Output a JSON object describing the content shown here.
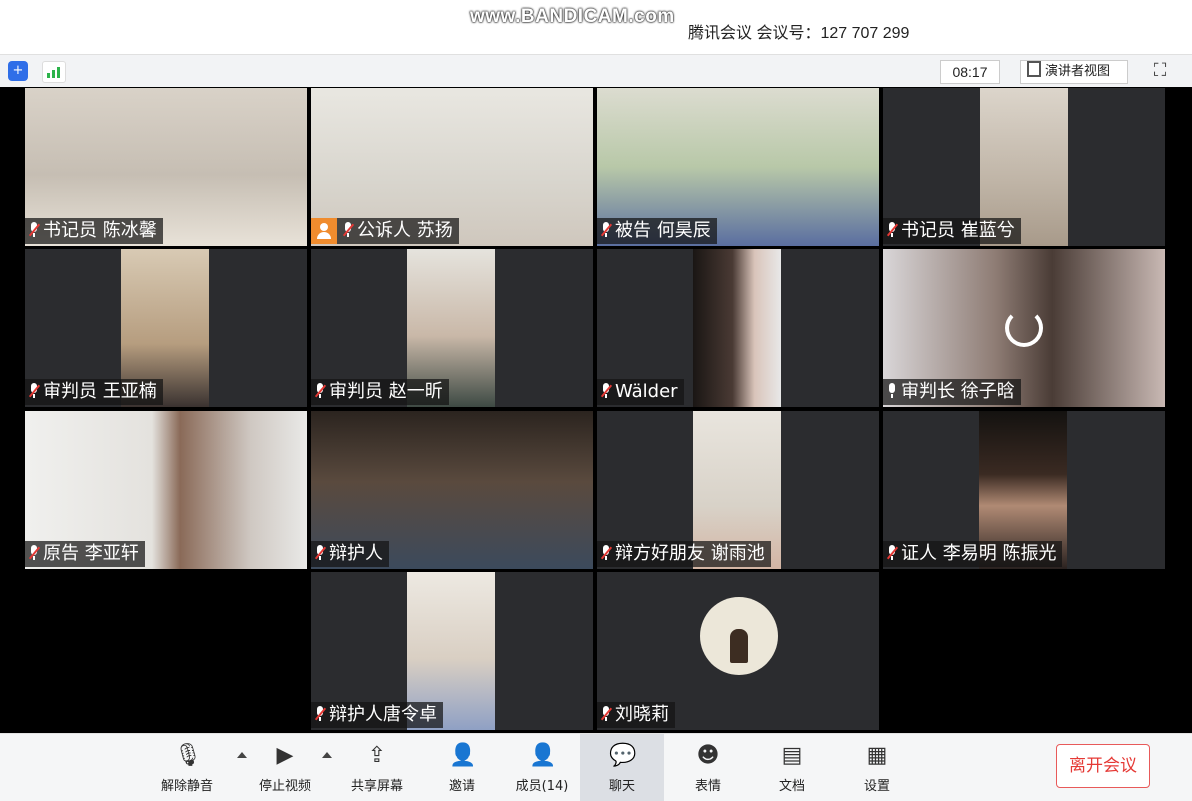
{
  "watermark": "www.BANDICAM.com",
  "title": "腾讯会议 会议号：127 707 299",
  "toolbar": {
    "timer": "08:17",
    "speaker_view": "演讲者视图"
  },
  "participants": [
    {
      "label": "书记员 陈冰馨",
      "muted": true
    },
    {
      "label": "公诉人 苏扬",
      "muted": true
    },
    {
      "label": "被告 何昊辰",
      "muted": true
    },
    {
      "label": "书记员 崔蓝兮",
      "muted": true
    },
    {
      "label": "审判员 王亚楠",
      "muted": true
    },
    {
      "label": "审判员 赵一昕",
      "muted": true
    },
    {
      "label": "Wälder",
      "muted": true
    },
    {
      "label": "审判长 徐子晗",
      "muted": false
    },
    {
      "label": "原告 李亚轩",
      "muted": true
    },
    {
      "label": "辩护人",
      "muted": true
    },
    {
      "label": "辩方好朋友 谢雨池",
      "muted": true
    },
    {
      "label": "证人 李易明 陈振光",
      "muted": true
    },
    {
      "label": "辩护人唐令卓",
      "muted": true
    },
    {
      "label": "刘晓莉",
      "muted": true
    }
  ],
  "bottom_bar": {
    "unmute": "解除静音",
    "stop_video": "停止视频",
    "share_screen": "共享屏幕",
    "invite": "邀请",
    "members": "成员(14)",
    "chat": "聊天",
    "reactions": "表情",
    "docs": "文档",
    "settings": "设置",
    "leave": "离开会议"
  },
  "colors": {
    "muted_mic": "#e53935",
    "leave_button": "#e53935",
    "stage_background": "#000000",
    "tile_background": "#2b2c2f"
  }
}
